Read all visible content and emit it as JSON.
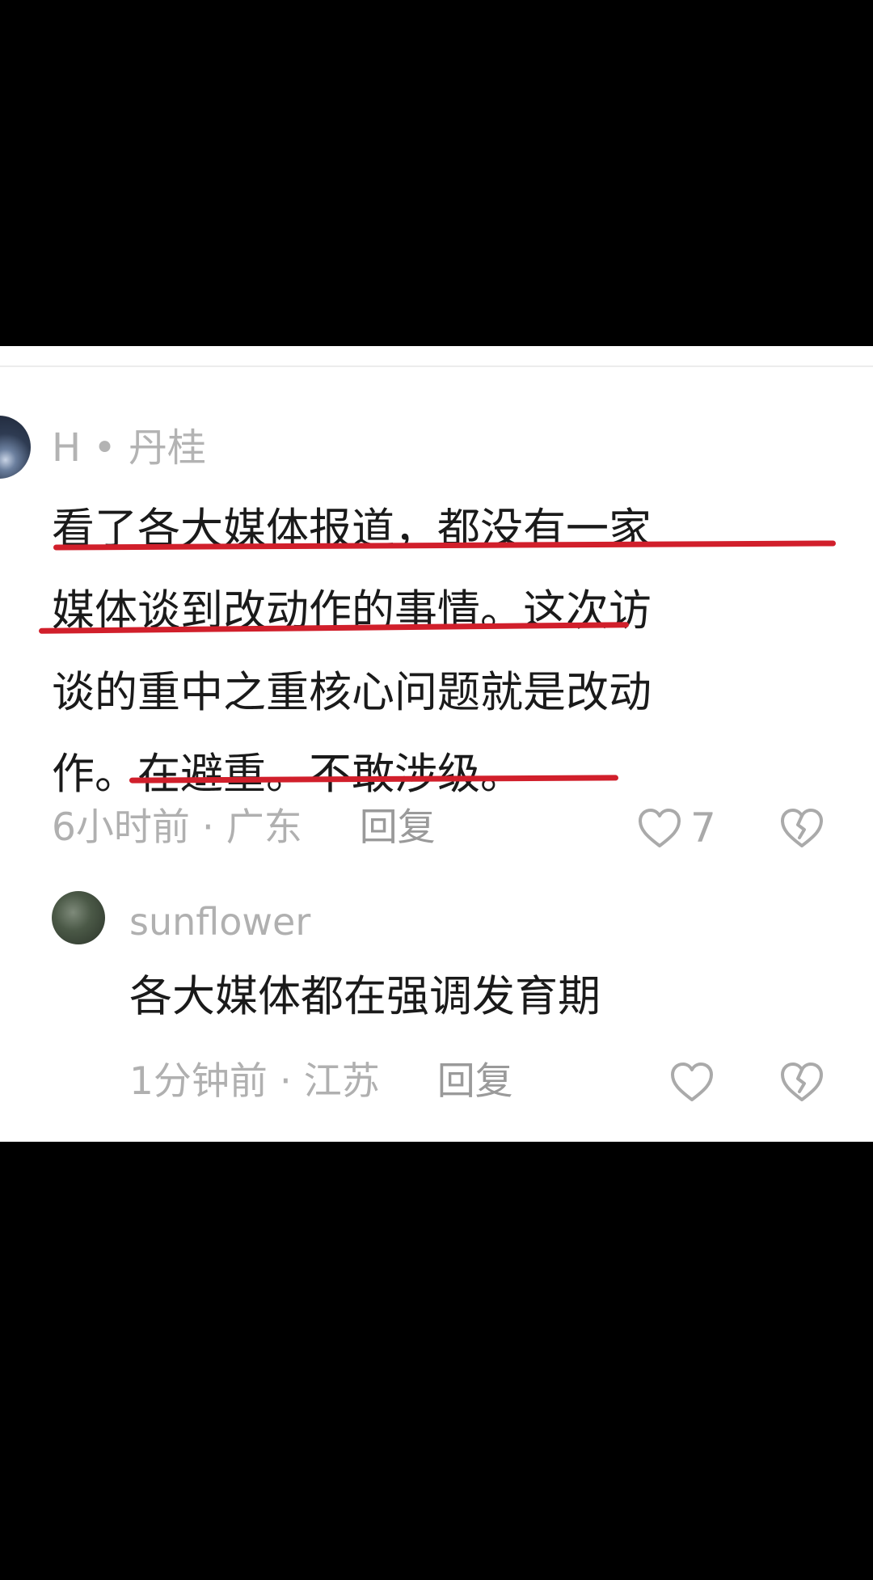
{
  "comment": {
    "username": "H • 丹桂",
    "text_lines": [
      "看了各大媒体报道，都没有一家",
      "媒体谈到改动作的事情。这次访",
      "谈的重中之重核心问题就是改动",
      "作。在避重。不敢涉级。"
    ],
    "time_location": "6小时前 · 广东",
    "reply_label": "回复",
    "like_count": "7"
  },
  "reply": {
    "username": "sunflower",
    "text": "各大媒体都在强调发育期",
    "time_location": "1分钟前 · 江苏",
    "reply_label": "回复"
  },
  "colors": {
    "highlight_underline": "#d11f2b",
    "meta_text": "#b0b0b0",
    "body_text": "#1a1a1a"
  },
  "icons": {
    "like": "heart-outline-icon",
    "dislike": "broken-heart-icon"
  }
}
